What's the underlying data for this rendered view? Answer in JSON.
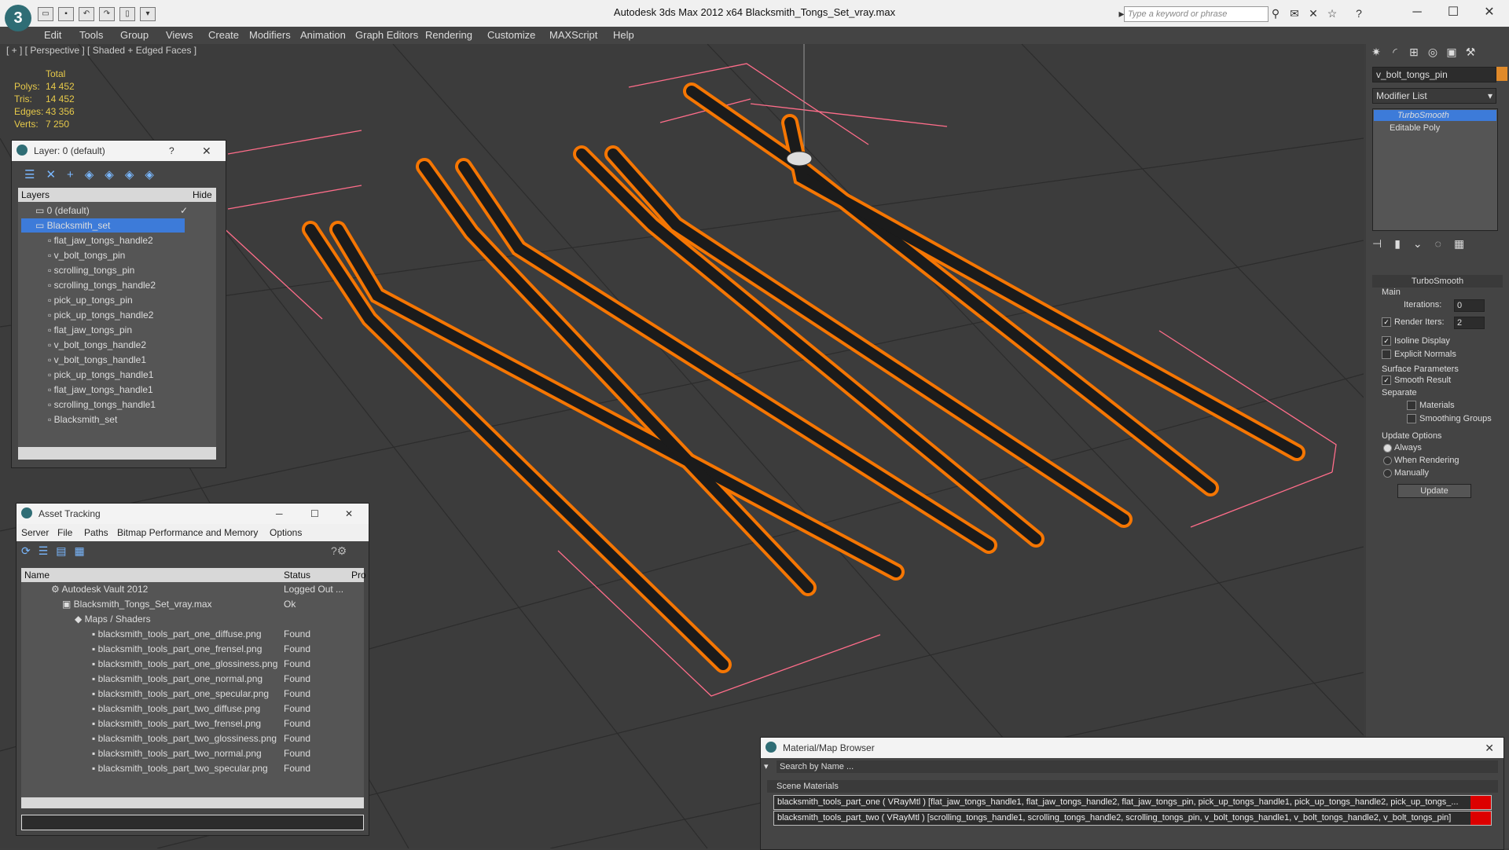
{
  "app": {
    "logo": "3",
    "title": "Autodesk 3ds Max  2012 x64      Blacksmith_Tongs_Set_vray.max",
    "search_placeholder": "Type a keyword or phrase"
  },
  "menu": [
    "Edit",
    "Tools",
    "Group",
    "Views",
    "Create",
    "Modifiers",
    "Animation",
    "Graph Editors",
    "Rendering",
    "Customize",
    "MAXScript",
    "Help"
  ],
  "viewport": {
    "label": "[ + ] [ Perspective ] [ Shaded + Edged Faces ]",
    "stats_header": "Total",
    "stats": [
      {
        "k": "Polys:",
        "v": "14 452"
      },
      {
        "k": "Tris:",
        "v": "14 452"
      },
      {
        "k": "Edges:",
        "v": "43 356"
      },
      {
        "k": "Verts:",
        "v": "7 250"
      }
    ]
  },
  "layer_panel": {
    "title": "Layer: 0 (default)",
    "help": "?",
    "col_layers": "Layers",
    "col_hide": "Hide",
    "rows": [
      "0 (default)",
      "Blacksmith_set",
      "flat_jaw_tongs_handle2",
      "v_bolt_tongs_pin",
      "scrolling_tongs_pin",
      "scrolling_tongs_handle2",
      "pick_up_tongs_pin",
      "pick_up_tongs_handle2",
      "flat_jaw_tongs_pin",
      "v_bolt_tongs_handle2",
      "v_bolt_tongs_handle1",
      "pick_up_tongs_handle1",
      "flat_jaw_tongs_handle1",
      "scrolling_tongs_handle1",
      "Blacksmith_set"
    ]
  },
  "asset_tracking": {
    "title": "Asset Tracking",
    "menu": [
      "Server",
      "File",
      "Paths",
      "Bitmap Performance and Memory",
      "Options"
    ],
    "col_name": "Name",
    "col_status": "Status",
    "col_pro": "Pro",
    "rows": [
      {
        "name": "Autodesk Vault 2012",
        "status": "Logged Out ..."
      },
      {
        "name": "Blacksmith_Tongs_Set_vray.max",
        "status": "Ok"
      },
      {
        "name": "Maps / Shaders",
        "status": ""
      },
      {
        "name": "blacksmith_tools_part_one_diffuse.png",
        "status": "Found"
      },
      {
        "name": "blacksmith_tools_part_one_frensel.png",
        "status": "Found"
      },
      {
        "name": "blacksmith_tools_part_one_glossiness.png",
        "status": "Found"
      },
      {
        "name": "blacksmith_tools_part_one_normal.png",
        "status": "Found"
      },
      {
        "name": "blacksmith_tools_part_one_specular.png",
        "status": "Found"
      },
      {
        "name": "blacksmith_tools_part_two_diffuse.png",
        "status": "Found"
      },
      {
        "name": "blacksmith_tools_part_two_frensel.png",
        "status": "Found"
      },
      {
        "name": "blacksmith_tools_part_two_glossiness.png",
        "status": "Found"
      },
      {
        "name": "blacksmith_tools_part_two_normal.png",
        "status": "Found"
      },
      {
        "name": "blacksmith_tools_part_two_specular.png",
        "status": "Found"
      }
    ]
  },
  "command_panel": {
    "object_name": "v_bolt_tongs_pin",
    "modifier_list": "Modifier List",
    "stack": [
      "TurboSmooth",
      "Editable Poly"
    ],
    "rollout": "TurboSmooth",
    "main": "Main",
    "iterations_label": "Iterations:",
    "iterations": "0",
    "render_iters_label": "Render Iters:",
    "render_iters": "2",
    "isoline": "Isoline Display",
    "explicit": "Explicit Normals",
    "surface": "Surface Parameters",
    "smooth_result": "Smooth Result",
    "separate": "Separate",
    "materials": "Materials",
    "smoothing_groups": "Smoothing Groups",
    "update_options": "Update Options",
    "always": "Always",
    "when_rendering": "When Rendering",
    "manually": "Manually",
    "update": "Update"
  },
  "material_browser": {
    "title": "Material/Map Browser",
    "search": "Search by Name ...",
    "section": "Scene Materials",
    "rows": [
      "blacksmith_tools_part_one ( VRayMtl ) [flat_jaw_tongs_handle1, flat_jaw_tongs_handle2, flat_jaw_tongs_pin, pick_up_tongs_handle1, pick_up_tongs_handle2, pick_up_tongs_...",
      "blacksmith_tools_part_two ( VRayMtl ) [scrolling_tongs_handle1, scrolling_tongs_handle2, scrolling_tongs_pin, v_bolt_tongs_handle1, v_bolt_tongs_handle2, v_bolt_tongs_pin]"
    ]
  },
  "colors": {
    "wire": "#ff7a00",
    "selection": "#ff6d8a",
    "accent": "#3d7bd9"
  }
}
